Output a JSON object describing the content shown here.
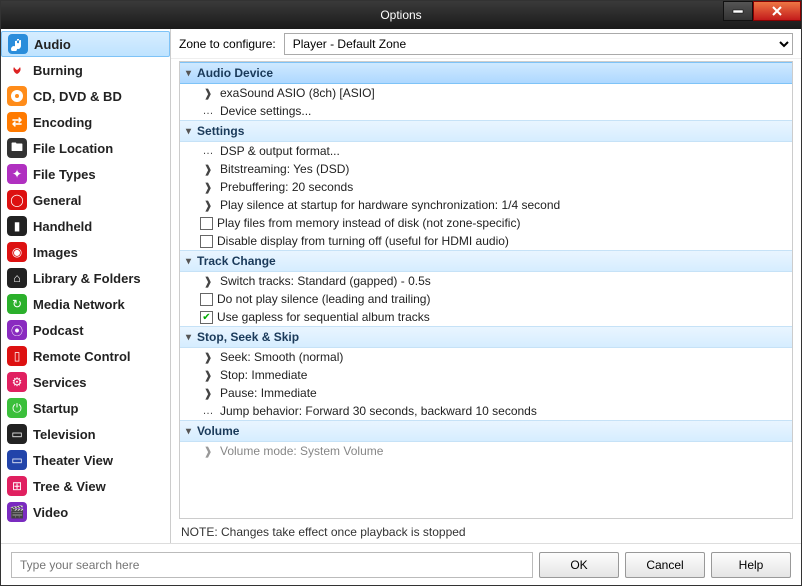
{
  "window": {
    "title": "Options"
  },
  "sidebar": [
    {
      "label": "Audio"
    },
    {
      "label": "Burning"
    },
    {
      "label": "CD, DVD & BD"
    },
    {
      "label": "Encoding"
    },
    {
      "label": "File Location"
    },
    {
      "label": "File Types"
    },
    {
      "label": "General"
    },
    {
      "label": "Handheld"
    },
    {
      "label": "Images"
    },
    {
      "label": "Library & Folders"
    },
    {
      "label": "Media Network"
    },
    {
      "label": "Podcast"
    },
    {
      "label": "Remote Control"
    },
    {
      "label": "Services"
    },
    {
      "label": "Startup"
    },
    {
      "label": "Television"
    },
    {
      "label": "Theater View"
    },
    {
      "label": "Tree & View"
    },
    {
      "label": "Video"
    }
  ],
  "main": {
    "zone_label": "Zone to configure:",
    "zone_value": "Player - Default Zone",
    "groups": [
      {
        "title": "Audio Device",
        "items": [
          "exaSound ASIO (8ch) [ASIO]",
          "Device settings..."
        ]
      },
      {
        "title": "Settings",
        "items": [
          "DSP & output format...",
          "Bitstreaming: Yes (DSD)",
          "Prebuffering: 20 seconds",
          "Play silence at startup for hardware synchronization: 1/4 second",
          "Play files from memory instead of disk (not zone-specific)",
          "Disable display from turning off (useful for HDMI audio)"
        ]
      },
      {
        "title": "Track Change",
        "items": [
          "Switch tracks: Standard (gapped) - 0.5s",
          "Do not play silence (leading and trailing)",
          "Use gapless for sequential album tracks"
        ]
      },
      {
        "title": "Stop, Seek & Skip",
        "items": [
          "Seek: Smooth (normal)",
          "Stop: Immediate",
          "Pause: Immediate",
          "Jump behavior: Forward 30 seconds, backward 10 seconds"
        ]
      },
      {
        "title": "Volume",
        "items": [
          "Volume mode: System Volume"
        ]
      }
    ],
    "note": "NOTE: Changes take effect once playback is stopped"
  },
  "footer": {
    "search_placeholder": "Type your search here",
    "ok": "OK",
    "cancel": "Cancel",
    "help": "Help"
  }
}
